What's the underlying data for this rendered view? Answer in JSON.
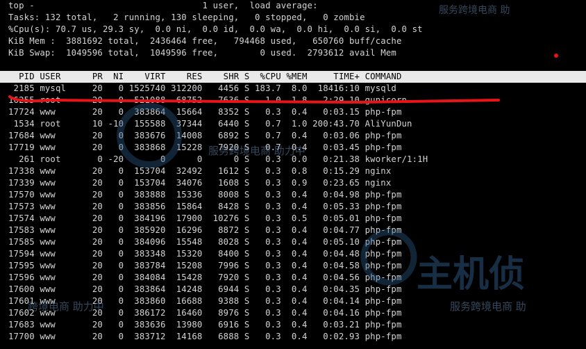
{
  "summary": {
    "line1": "top -                                1 user,  load average:",
    "line2": "Tasks: 132 total,   2 running, 130 sleeping,   0 stopped,   0 zombie",
    "line3": "%Cpu(s): 70.7 us, 29.3 sy,  0.0 ni,  0.0 id,  0.0 wa,  0.0 hi,  0.0 si,  0.0 st",
    "line4": "KiB Mem :  3881692 total,  2436464 free,   794468 used,   650760 buff/cache",
    "line5": "KiB Swap:  1049596 total,  1049596 free,        0 used.  2793612 avail Mem"
  },
  "table": {
    "header": "  PID USER      PR  NI    VIRT    RES    SHR S  %CPU %MEM     TIME+ COMMAND",
    "rows": [
      " 2185 mysql     20   0 1525740 312200   4456 S 183.7  8.0  18416:10 mysqld",
      "16255 root      20   0  521088  68752   7636 S   1.0  1.8   2:29.10 gunicorn",
      "17724 www       20   0  383864  15664   8352 S   0.3  0.4   0:03.15 php-fpm",
      " 1534 root      10 -10  155588  37344   6440 S   0.7  1.0 200:43.70 AliYunDun",
      "17684 www       20   0  383676  14008   6892 S   0.7  0.4   0:03.06 php-fpm",
      "17719 www       20   0  383868  15228   7920 S   0.7  0.4   0:03.45 php-fpm",
      "  261 root       0 -20       0      0      0 S   0.3  0.0   0:21.38 kworker/1:1H",
      "17338 www       20   0  153704  32492   1612 S   0.3  0.8   0:15.29 nginx",
      "17339 www       20   0  153704  34076   1608 S   0.3  0.9   0:23.65 nginx",
      "17570 www       20   0  383888  15336   8008 S   0.3  0.4   0:04.98 php-fpm",
      "17573 www       20   0  383856  15864   8428 S   0.3  0.4   0:05.33 php-fpm",
      "17574 www       20   0  384196  17900  10276 S   0.3  0.5   0:05.01 php-fpm",
      "17583 www       20   0  385920  16296   8872 S   0.3  0.4   0:04.77 php-fpm",
      "17585 www       20   0  384096  15548   8028 S   0.3  0.4   0:05.10 php-fpm",
      "17594 www       20   0  383348  15320   8400 S   0.3  0.4   0:04.48 php-fpm",
      "17595 www       20   0  383784  15208   7996 S   0.3  0.4   0:04.58 php-fpm",
      "17596 www       20   0  384084  15428   7920 S   0.3  0.4   0:04.56 php-fpm",
      "17600 www       20   0  383864  14248   6944 S   0.3  0.4   0:04.35 php-fpm",
      "17601 www       20   0  383860  16688   9388 S   0.3  0.4   0:04.14 php-fpm",
      "17602 www       20   0  386172  16460   8976 S   0.3  0.4   0:04.16 php-fpm",
      "17683 www       20   0  383636  13980   6916 S   0.3  0.4   0:03.21 php-fpm",
      "17700 www       20   0  383712  14168   6888 S   0.3  0.4   0:02.93 php-fpm"
    ]
  },
  "watermark": {
    "text1": "服务跨境电商 助",
    "text2": "服务跨境电商 助力中",
    "text3": "主机侦",
    "text4": "跨境电商 助力中",
    "text5": "服务跨境电商 助"
  },
  "colors": {
    "background": "#000000",
    "text": "#d4d4d4",
    "header_bg": "#e9e9e9",
    "annotation_red": "#e8141a",
    "watermark": "#3c6b9a"
  }
}
